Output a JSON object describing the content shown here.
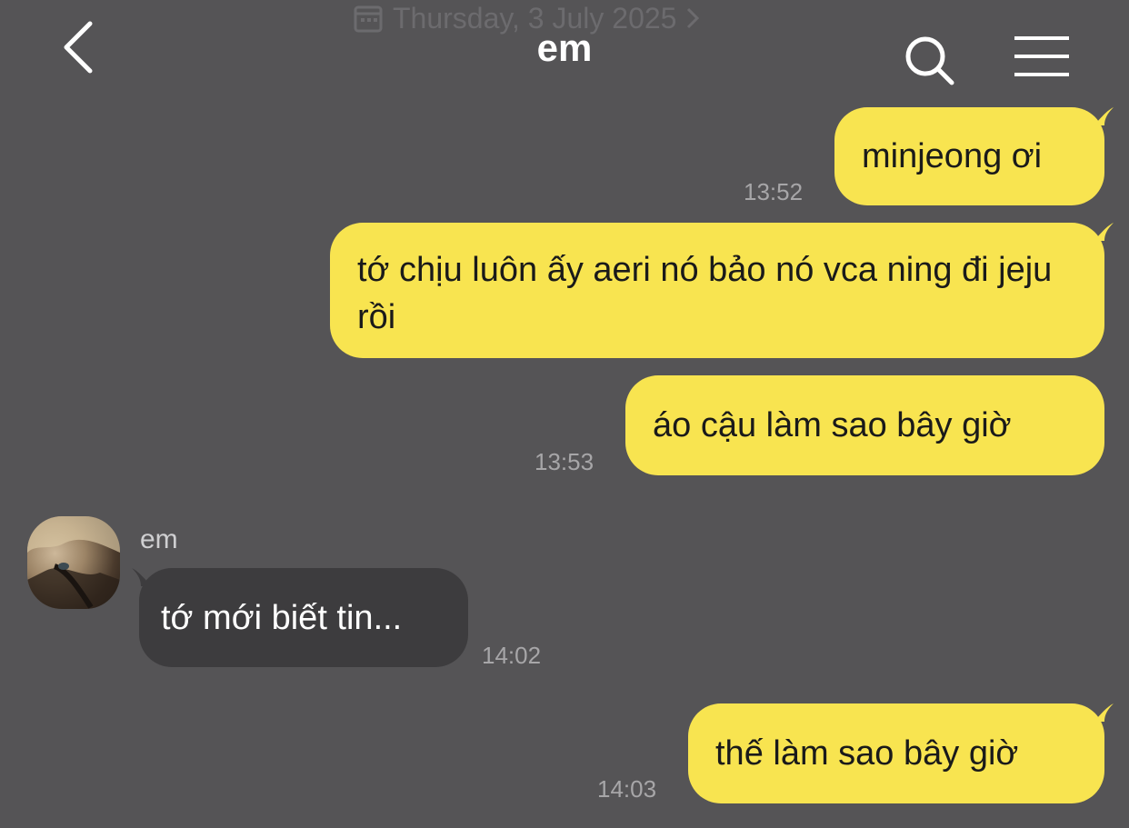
{
  "header": {
    "title": "em",
    "date_label": "Thursday, 3 July 2025"
  },
  "messages": [
    {
      "direction": "out",
      "text": "minjeong ơi",
      "time": "13:52"
    },
    {
      "direction": "out",
      "text": "tớ chịu luôn ấy aeri nó bảo nó vca ning đi jeju rồi",
      "time": ""
    },
    {
      "direction": "out",
      "text": "áo cậu làm sao bây giờ",
      "time": "13:53"
    },
    {
      "direction": "in",
      "sender": "em",
      "text": "tớ mới biết tin...",
      "time": "14:02"
    },
    {
      "direction": "out",
      "text": "thế làm sao bây giờ",
      "time": "14:03"
    }
  ],
  "icons": {
    "back": "chevron-left-icon",
    "search": "search-icon",
    "menu": "hamburger-menu-icon",
    "calendar": "calendar-icon"
  },
  "colors": {
    "background": "#555456",
    "outgoing_bubble": "#f8e450",
    "incoming_bubble": "#3d3c3e",
    "time_text": "#a7a6a8"
  }
}
